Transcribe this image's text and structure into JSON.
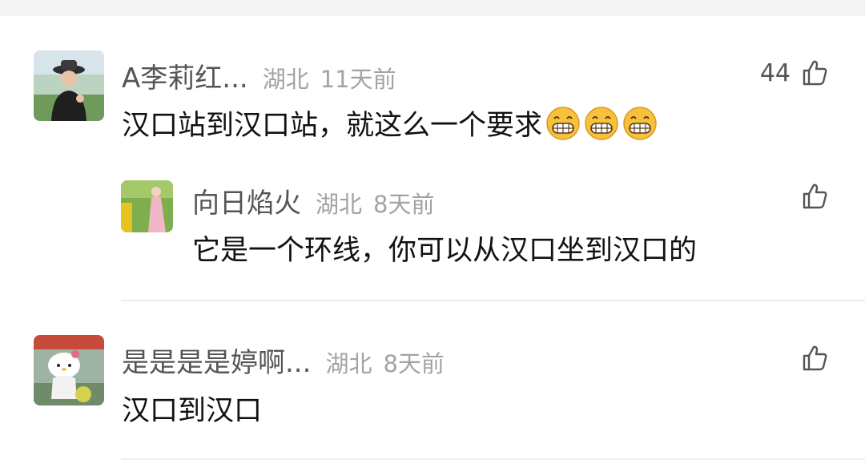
{
  "comments": [
    {
      "name": "A李莉红...",
      "location": "湖北",
      "time": "11天前",
      "likes": "44",
      "text": "汉口站到汉口站，就这么一个要求",
      "emoji_count": 3,
      "emoji_name": "grinning-face-icon"
    },
    {
      "name": "向日焰火",
      "location": "湖北",
      "time": "8天前",
      "likes": "",
      "text": "它是一个环线，你可以从汉口坐到汉口的"
    },
    {
      "name": "是是是是婷啊...",
      "location": "湖北",
      "time": "8天前",
      "likes": "",
      "text": "汉口到汉口"
    }
  ],
  "colors": {
    "name": "#555555",
    "meta": "#a3a3a3",
    "body": "#111111",
    "divider": "#ececec",
    "emoji_fill": "#f7c13c"
  }
}
